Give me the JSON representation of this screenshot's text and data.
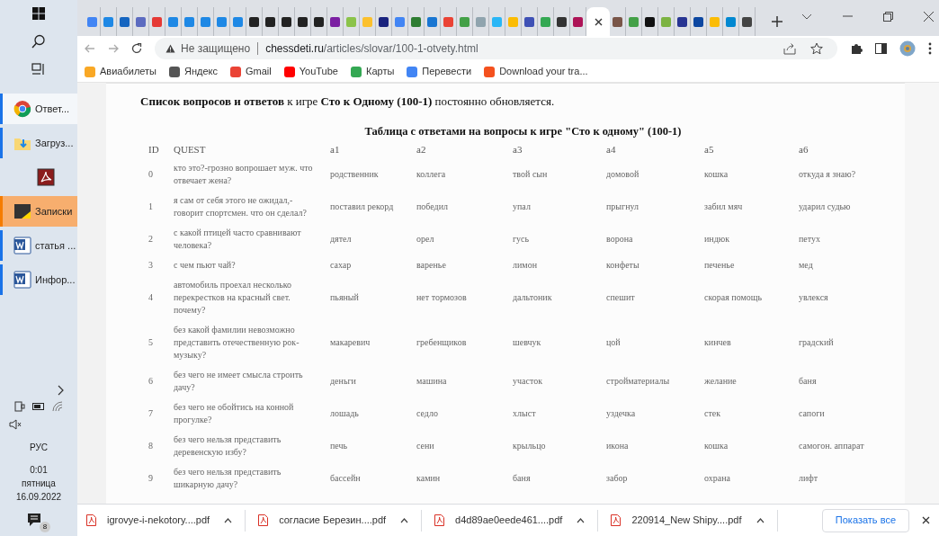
{
  "taskbar": {
    "apps": [
      {
        "label": "Ответ...",
        "kind": "chrome",
        "selected": true,
        "running": true,
        "flashing": false
      },
      {
        "label": "Загруз...",
        "kind": "folder",
        "selected": false,
        "running": true,
        "flashing": false
      },
      {
        "kind": "pdf",
        "selected": false,
        "running": false,
        "flashing": false
      },
      {
        "label": "Записки",
        "kind": "notes",
        "selected": false,
        "running": true,
        "flashing": true
      },
      {
        "label": "статья ...",
        "kind": "word",
        "selected": false,
        "running": true,
        "flashing": false
      },
      {
        "label": "Инфор...",
        "kind": "word",
        "selected": false,
        "running": true,
        "flashing": false
      }
    ],
    "language": "РУС",
    "time": "0:01",
    "weekday": "пятница",
    "date": "16.09.2022",
    "notifications": "8"
  },
  "tabs": [
    {
      "selected": false,
      "color": "#4285f4"
    },
    {
      "selected": false,
      "color": "#1e88e5"
    },
    {
      "selected": false,
      "color": "#1565c0"
    },
    {
      "selected": false,
      "color": "#5c6bc0"
    },
    {
      "selected": false,
      "color": "#e53935"
    },
    {
      "selected": false,
      "color": "#1e88e5"
    },
    {
      "selected": false,
      "color": "#1e88e5"
    },
    {
      "selected": false,
      "color": "#1e88e5"
    },
    {
      "selected": false,
      "color": "#1e88e5"
    },
    {
      "selected": false,
      "color": "#1e88e5"
    },
    {
      "selected": false,
      "color": "#222222"
    },
    {
      "selected": false,
      "color": "#222222"
    },
    {
      "selected": false,
      "color": "#222222"
    },
    {
      "selected": false,
      "color": "#222222"
    },
    {
      "selected": false,
      "color": "#222222"
    },
    {
      "selected": false,
      "color": "#7b1fa2"
    },
    {
      "selected": false,
      "color": "#8bc34a"
    },
    {
      "selected": false,
      "color": "#fbc02d"
    },
    {
      "selected": false,
      "color": "#1a237e"
    },
    {
      "selected": false,
      "color": "#4285f4"
    },
    {
      "selected": false,
      "color": "#2e7d32"
    },
    {
      "selected": false,
      "color": "#1976d2"
    },
    {
      "selected": false,
      "color": "#ea4335"
    },
    {
      "selected": false,
      "color": "#43a047"
    },
    {
      "selected": false,
      "color": "#90a4ae"
    },
    {
      "selected": false,
      "color": "#29b6f6"
    },
    {
      "selected": false,
      "color": "#fbbc04"
    },
    {
      "selected": false,
      "color": "#3f51b5"
    },
    {
      "selected": false,
      "color": "#34a853"
    },
    {
      "selected": false,
      "color": "#333333"
    },
    {
      "selected": false,
      "color": "#ad1457"
    },
    {
      "selected": true
    },
    {
      "selected": false,
      "color": "#795548"
    },
    {
      "selected": false,
      "color": "#43a047"
    },
    {
      "selected": false,
      "color": "#111111"
    },
    {
      "selected": false,
      "color": "#7cb342"
    },
    {
      "selected": false,
      "color": "#283593"
    },
    {
      "selected": false,
      "color": "#0d47a1"
    },
    {
      "selected": false,
      "color": "#fbbc05"
    },
    {
      "selected": false,
      "color": "#0288d1"
    },
    {
      "selected": false,
      "color": "#444444"
    }
  ],
  "address_bar": {
    "security": "Не защищено",
    "domain": "chessdeti.ru",
    "path": "/articles/slovar/100-1-otvety.html"
  },
  "bookmarks": [
    {
      "label": "Авиабилеты",
      "color": "#f9a825"
    },
    {
      "label": "Яндекс",
      "color": "#555555"
    },
    {
      "label": "Gmail",
      "color": "#ea4335"
    },
    {
      "label": "YouTube",
      "color": "#ff0000"
    },
    {
      "label": "Карты",
      "color": "#34a853"
    },
    {
      "label": "Перевести",
      "color": "#4285f4"
    },
    {
      "label": "Download your tra...",
      "color": "#f4511e"
    }
  ],
  "page": {
    "intro": "**Список вопросов и ответов** к игре **Сто к Одному (100-1)** постоянно обновляется.",
    "table": {
      "caption": "Таблица с ответами на вопросы к игре \"Сто к одному\" (100-1)",
      "columns": [
        "ID",
        "QUEST",
        "a1",
        "a2",
        "a3",
        "a4",
        "a5",
        "a6"
      ],
      "rows": [
        [
          "0",
          "кто это?-грозно вопрошает муж. что отвечает жена?",
          "родственник",
          "коллега",
          "твой сын",
          "домовой",
          "кошка",
          "откуда я знаю?"
        ],
        [
          "1",
          "я сам от себя этого не ожидал,- говорит спортсмен. что он сделал?",
          "поставил рекорд",
          "победил",
          "упал",
          "прыгнул",
          "забил мяч",
          "ударил судью"
        ],
        [
          "2",
          "с какой птицей часто сравнивают человека?",
          "дятел",
          "орел",
          "гусь",
          "ворона",
          "индюк",
          "петух"
        ],
        [
          "3",
          "с чем пьют чай?",
          "сахар",
          "варенье",
          "лимон",
          "конфеты",
          "печенье",
          "мед"
        ],
        [
          "4",
          "автомобиль проехал несколько перекрестков на красный свет. почему?",
          "пьяный",
          "нет тормозов",
          "дальтоник",
          "спешит",
          "скорая помощь",
          "увлекся"
        ],
        [
          "5",
          "без какой фамилии невозможно представить отечественную рок-музыку?",
          "макаревич",
          "гребенщиков",
          "шевчук",
          "цой",
          "кинчев",
          "градский"
        ],
        [
          "6",
          "без чего не имеет смысла строить дачу?",
          "деньги",
          "машина",
          "участок",
          "стройматериалы",
          "желание",
          "баня"
        ],
        [
          "7",
          "без чего не обойтись на конной прогулке?",
          "лошадь",
          "седло",
          "хлыст",
          "уздечка",
          "стек",
          "сапоги"
        ],
        [
          "8",
          "без чего нельзя представить деревенскую избу?",
          "печь",
          "сени",
          "крыльцо",
          "икона",
          "кошка",
          "самогон. аппарат"
        ],
        [
          "9",
          "без чего нельзя представить шикарную дачу?",
          "бассейн",
          "камин",
          "баня",
          "забор",
          "охрана",
          "лифт"
        ]
      ]
    }
  },
  "downloads": {
    "files": [
      "igrovye-i-nekotory....pdf",
      "согласие Березин....pdf",
      "d4d89ae0eede461....pdf",
      "220914_New Shipy....pdf"
    ],
    "show_all": "Показать все"
  }
}
